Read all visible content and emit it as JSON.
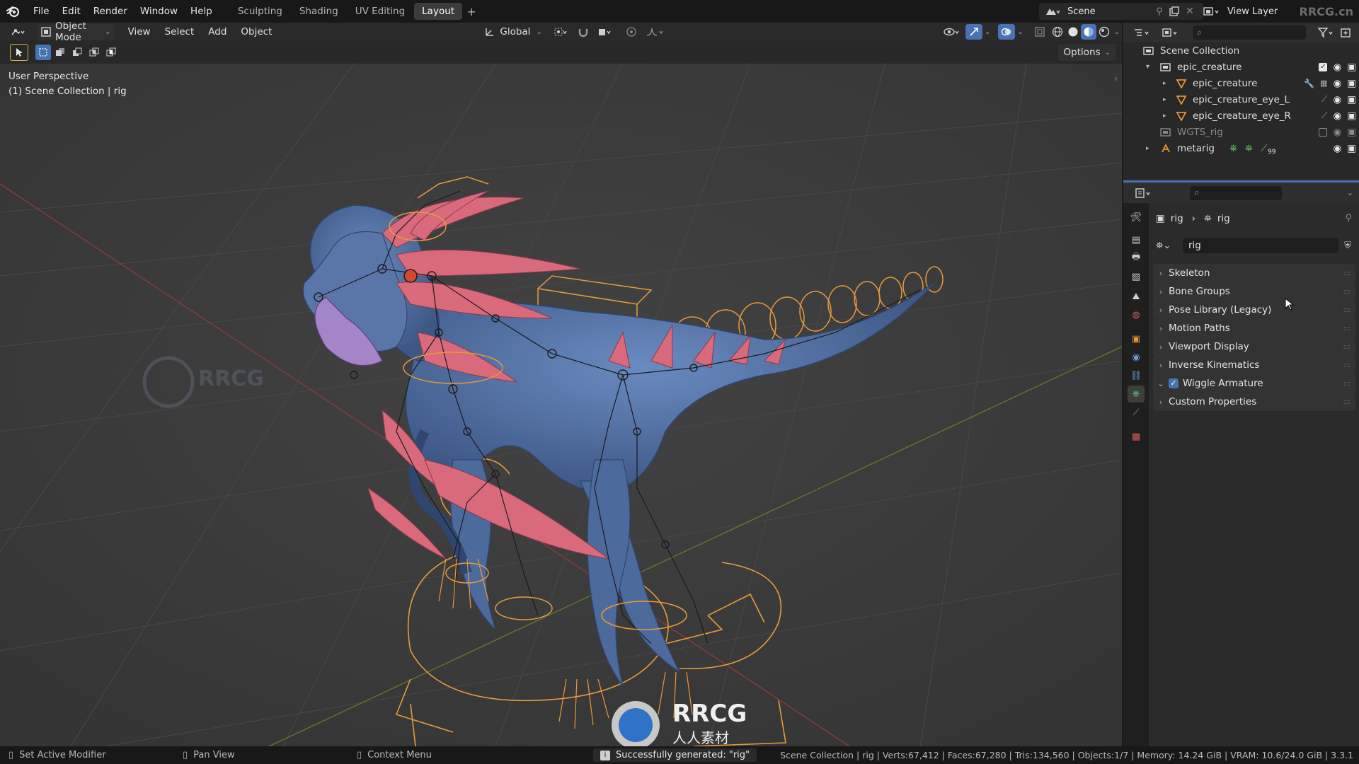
{
  "app": {
    "name": "Blender",
    "icons": {
      "logo": "blender-logo-icon"
    }
  },
  "topbar": {
    "menus": [
      "File",
      "Edit",
      "Render",
      "Window",
      "Help"
    ],
    "workspaces": [
      "Sculpting",
      "Shading",
      "UV Editing",
      "Layout"
    ],
    "active_workspace": "Layout",
    "add_workspace": "+",
    "scene": "Scene",
    "view_layer": "View Layer"
  },
  "viewport_header": {
    "mode": "Object Mode",
    "menus": [
      "View",
      "Select",
      "Add",
      "Object"
    ],
    "transform_orientation": "Global",
    "options": "Options"
  },
  "viewport": {
    "overlay_line1": "User Perspective",
    "overlay_line2": "(1) Scene Collection | rig",
    "accent_bone": "#e89a3c",
    "mesh_color": "#5a78a8",
    "spike_color": "#d86a7c",
    "watermark_main": "RRCG",
    "watermark_sub": "人人素材",
    "corner_watermark": "RRCG.cn"
  },
  "outliner": {
    "root": "Scene Collection",
    "items": [
      {
        "label": "epic_creature",
        "type": "collection"
      },
      {
        "label": "epic_creature",
        "type": "mesh"
      },
      {
        "label": "epic_creature_eye_L",
        "type": "mesh"
      },
      {
        "label": "epic_creature_eye_R",
        "type": "mesh"
      },
      {
        "label": "WGTS_rig",
        "type": "collection"
      },
      {
        "label": "metarig",
        "type": "armature",
        "badge": "99"
      }
    ]
  },
  "properties": {
    "breadcrumb": [
      "rig",
      "rig"
    ],
    "data_name": "rig",
    "panels": [
      {
        "label": "Skeleton",
        "expanded": false
      },
      {
        "label": "Bone Groups",
        "expanded": false
      },
      {
        "label": "Pose Library (Legacy)",
        "expanded": false
      },
      {
        "label": "Motion Paths",
        "expanded": false
      },
      {
        "label": "Viewport Display",
        "expanded": false
      },
      {
        "label": "Inverse Kinematics",
        "expanded": false
      },
      {
        "label": "Wiggle Armature",
        "expanded": true,
        "checkbox": true
      },
      {
        "label": "Custom Properties",
        "expanded": false
      }
    ]
  },
  "statusbar": {
    "left1": "Set Active Modifier",
    "left2": "Pan View",
    "left3": "Context Menu",
    "message": "Successfully generated: \"rig\"",
    "stats": "Scene Collection | rig | Verts:67,412 | Faces:67,280 | Tris:134,560 | Objects:1/7 | Memory: 14.24 GiB | VRAM: 10.6/24.0 GiB | 3.3.1"
  }
}
